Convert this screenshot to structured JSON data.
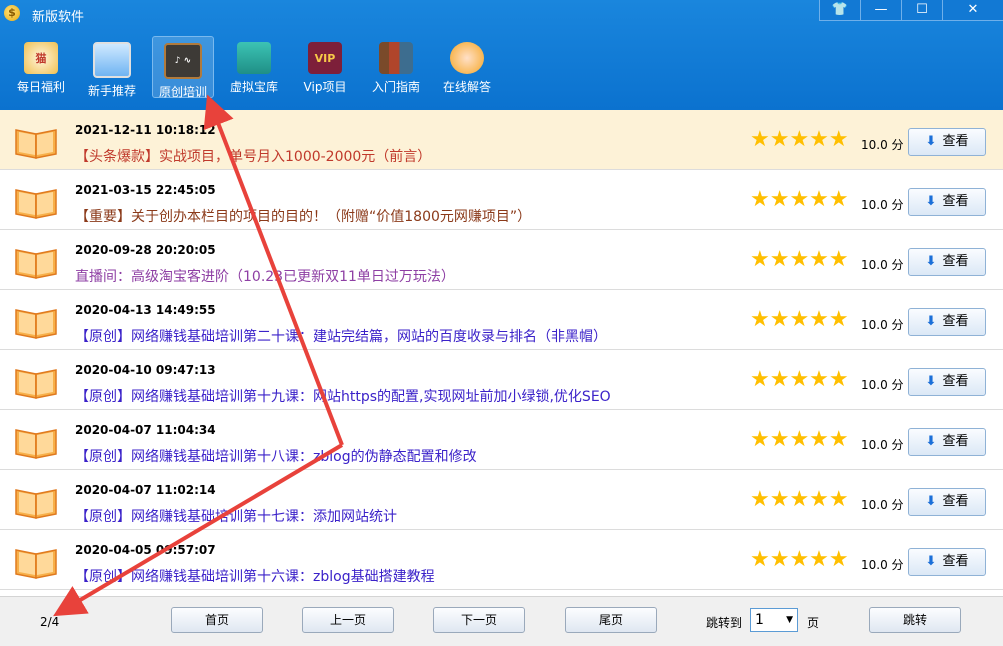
{
  "window": {
    "title": "新版软件",
    "buttons": [
      "shirt-icon",
      "minimize-icon",
      "maximize-icon",
      "close-icon"
    ]
  },
  "nav": [
    {
      "label": "每日福利",
      "icon": "lucky-cat-icon"
    },
    {
      "label": "新手推荐",
      "icon": "laptop-icon"
    },
    {
      "label": "原创培训",
      "icon": "chalkboard-icon",
      "active": true
    },
    {
      "label": "虚拟宝库",
      "icon": "warehouse-icon"
    },
    {
      "label": "Vip项目",
      "icon": "vip-icon",
      "badge": "VIP"
    },
    {
      "label": "入门指南",
      "icon": "books-icon"
    },
    {
      "label": "在线解答",
      "icon": "support-agent-icon"
    }
  ],
  "rows": [
    {
      "date": "2021-12-11 10:18:12",
      "title": "【头条爆款】实战项目，单号月入1000-2000元（前言）",
      "color": "#c0392b",
      "score": "10.0 分",
      "action": "查看",
      "highlight": true
    },
    {
      "date": "2021-03-15 22:45:05",
      "title": "【重要】关于创办本栏目的项目的目的！（附赠“价值1800元网赚项目”）",
      "color": "#8b3a1a",
      "score": "10.0 分",
      "action": "查看"
    },
    {
      "date": "2020-09-28 20:20:05",
      "title": "直播间：高级淘宝客进阶（10.23已更新双11单日过万玩法）",
      "color": "#8e3fa4",
      "score": "10.0 分",
      "action": "查看"
    },
    {
      "date": "2020-04-13 14:49:55",
      "title": "【原创】网络赚钱基础培训第二十课：建站完结篇，网站的百度收录与排名（非黑帽）",
      "color": "#3b22c9",
      "score": "10.0 分",
      "action": "查看"
    },
    {
      "date": "2020-04-10 09:47:13",
      "title": "【原创】网络赚钱基础培训第十九课：网站https的配置,实现网址前加小绿锁,优化SEO",
      "color": "#3b22c9",
      "score": "10.0 分",
      "action": "查看"
    },
    {
      "date": "2020-04-07 11:04:34",
      "title": "【原创】网络赚钱基础培训第十八课：zblog的伪静态配置和修改",
      "color": "#3b22c9",
      "score": "10.0 分",
      "action": "查看"
    },
    {
      "date": "2020-04-07 11:02:14",
      "title": "【原创】网络赚钱基础培训第十七课：添加网站统计",
      "color": "#3b22c9",
      "score": "10.0 分",
      "action": "查看"
    },
    {
      "date": "2020-04-05 09:57:07",
      "title": "【原创】网络赚钱基础培训第十六课：zblog基础搭建教程",
      "color": "#3b22c9",
      "score": "10.0 分",
      "action": "查看"
    }
  ],
  "rating_stars": "★★★★★",
  "footer": {
    "page_indicator": "2/4",
    "first": "首页",
    "prev": "上一页",
    "next": "下一页",
    "last": "尾页",
    "jump_label": "跳转到",
    "jump_value": "1",
    "jump_unit": "页",
    "jump_button": "跳转"
  },
  "colors": {
    "titlebar": "#0b72cf",
    "highlight_row": "#fdf2d7",
    "star": "#ffbf00",
    "annotation_arrow": "#e8423b"
  }
}
